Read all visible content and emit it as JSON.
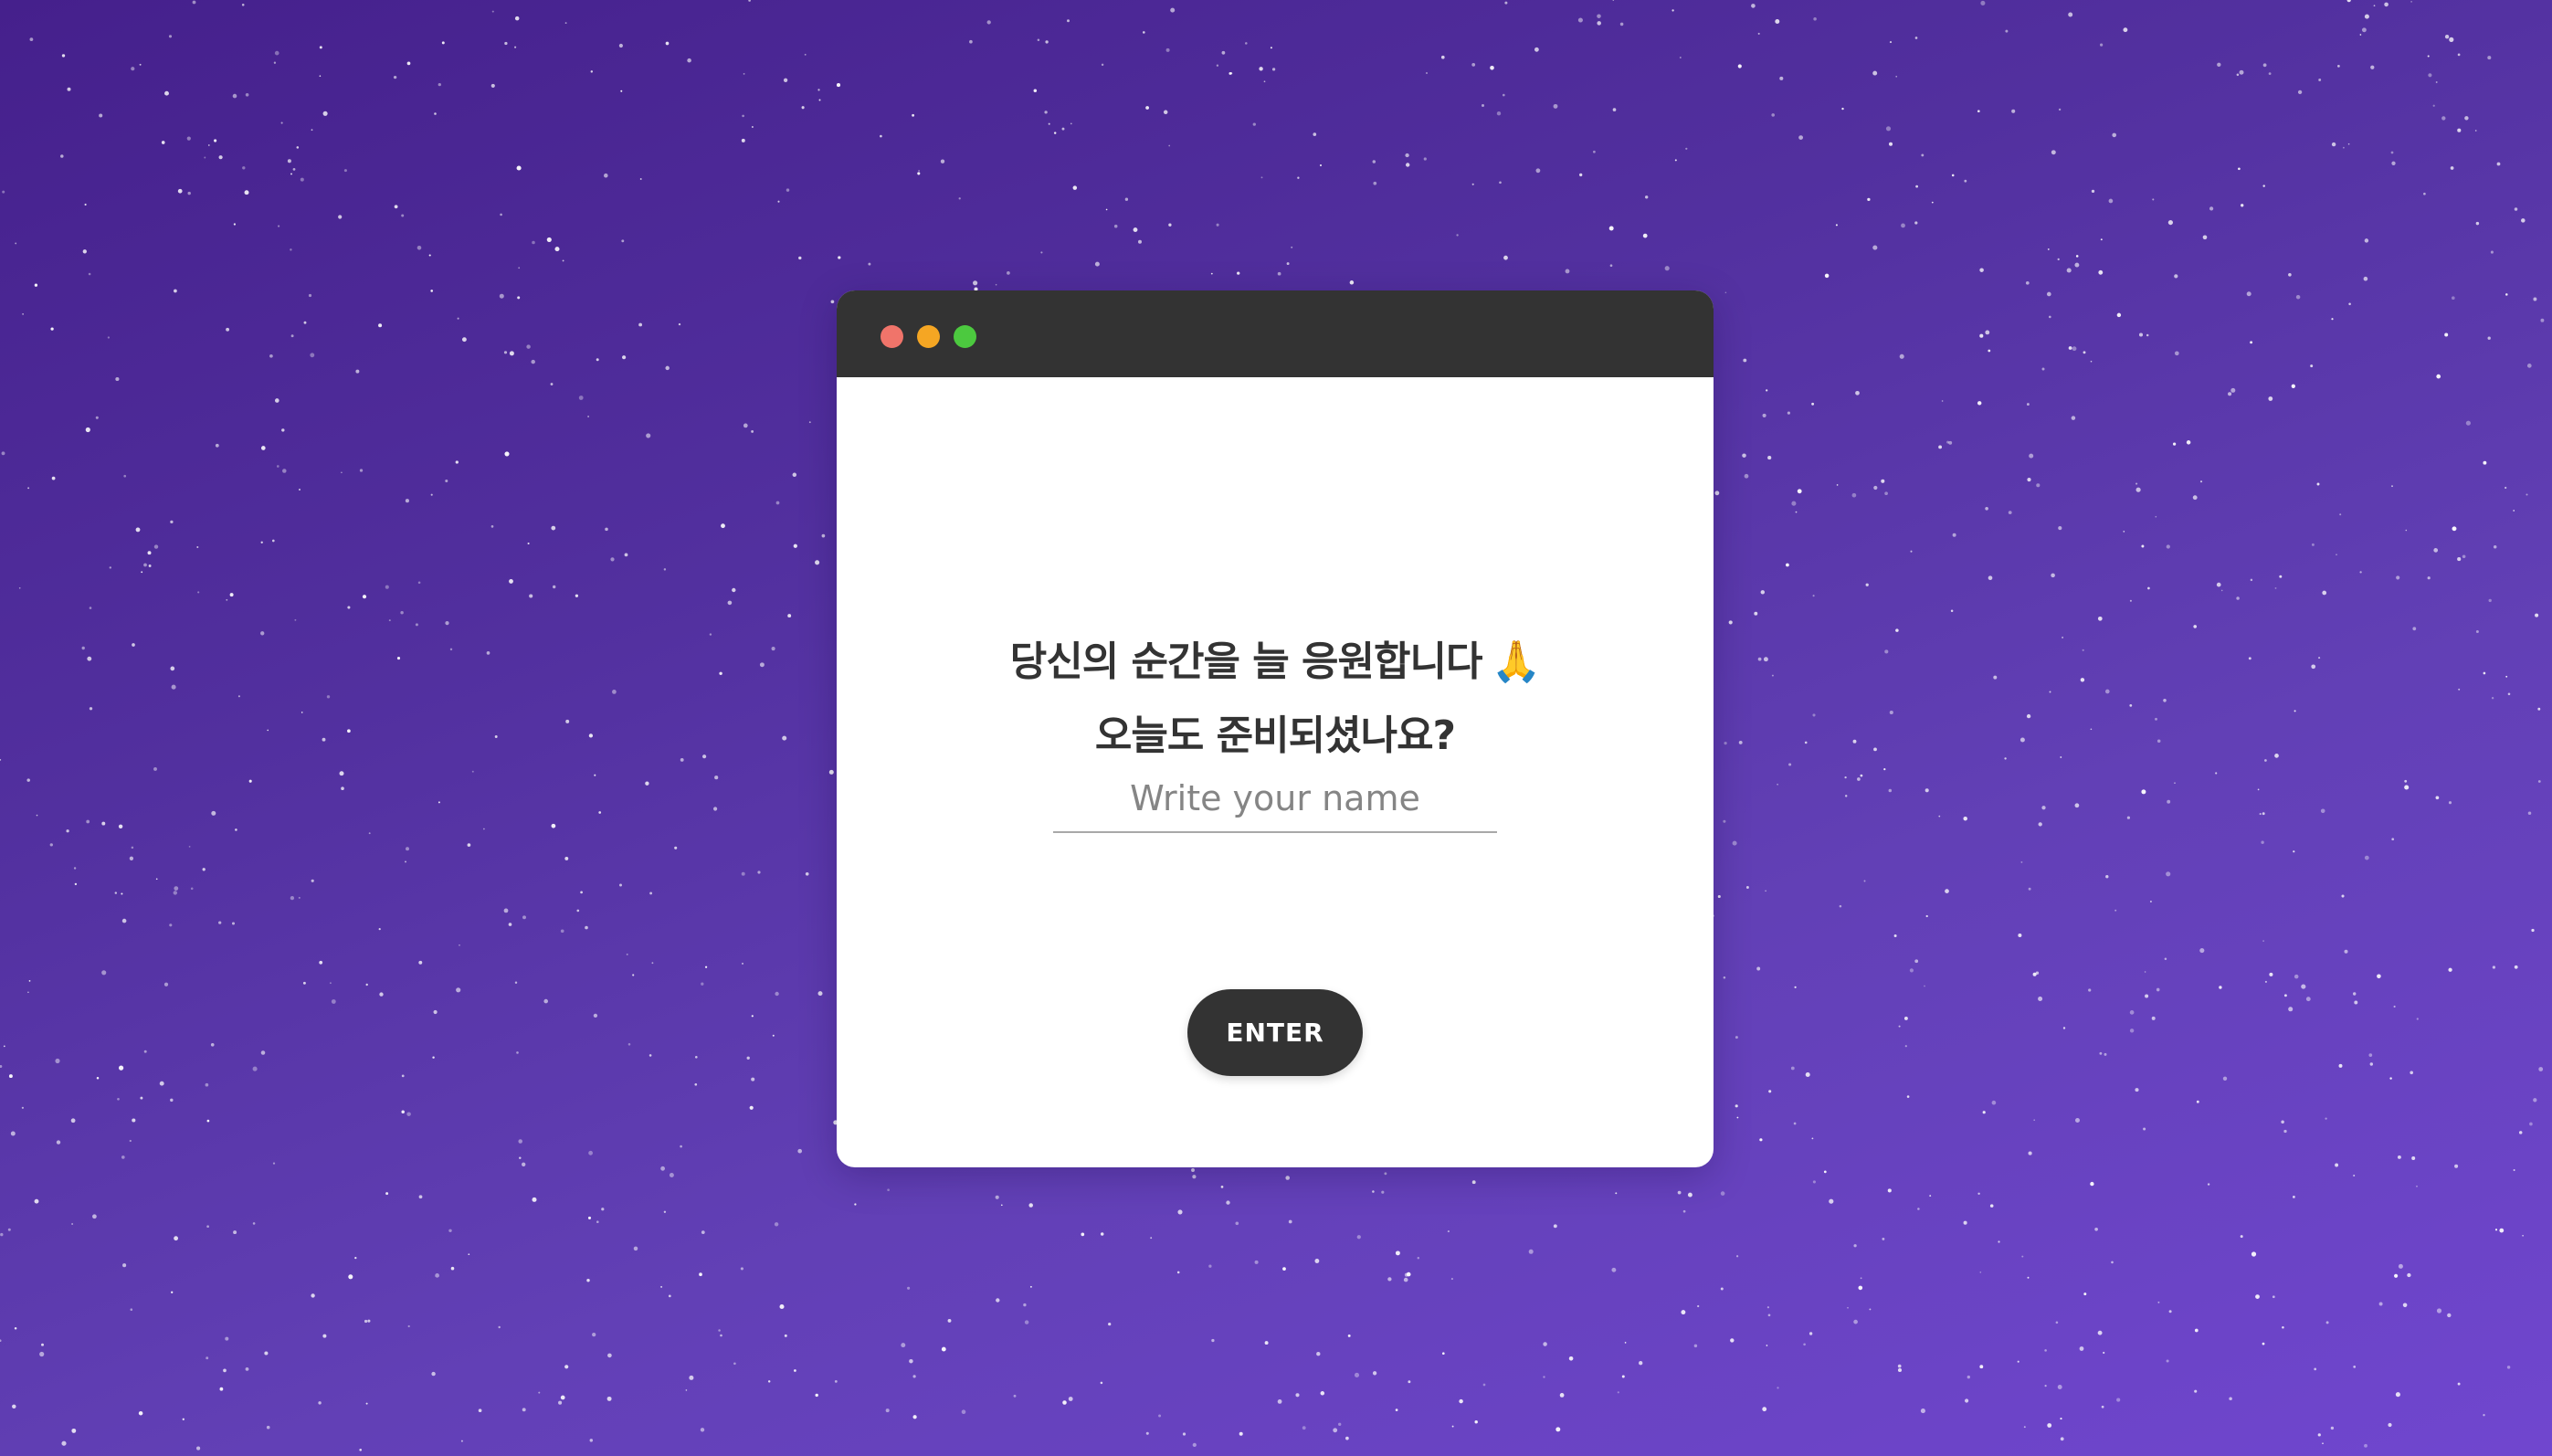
{
  "window": {
    "controls": {
      "close_color": "#f0746a",
      "minimize_color": "#f5a623",
      "maximize_color": "#4cc93f"
    }
  },
  "greeting": {
    "line1": "당신의 순간을 늘 응원합니다",
    "line1_emoji": "🙏",
    "line2": "오늘도 준비되셨나요?"
  },
  "form": {
    "name_placeholder": "Write your name",
    "name_value": "",
    "enter_label": "ENTER"
  },
  "colors": {
    "background_start": "#45208c",
    "background_end": "#7046cf",
    "titlebar": "#333333",
    "button": "#333333",
    "text": "#333333"
  }
}
